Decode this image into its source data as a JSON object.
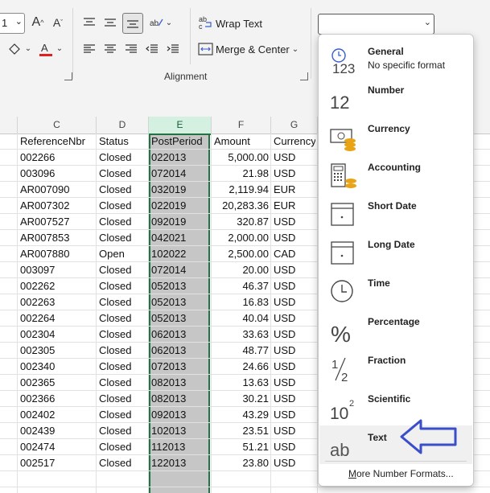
{
  "ribbon": {
    "font_size_value": "1",
    "wrap_text_label": "Wrap Text",
    "merge_center_label": "Merge & Center",
    "alignment_group_label": "Alignment",
    "number_format_value": ""
  },
  "sheet": {
    "columns": [
      "C",
      "D",
      "E",
      "F",
      "G"
    ],
    "headers": [
      "ReferenceNbr",
      "Status",
      "PostPeriod",
      "Amount",
      "Currency"
    ],
    "rows": [
      [
        "002266",
        "Closed",
        "022013",
        "5,000.00",
        "USD"
      ],
      [
        "003096",
        "Closed",
        "072014",
        "21.98",
        "USD"
      ],
      [
        "AR007090",
        "Closed",
        "032019",
        "2,119.94",
        "EUR"
      ],
      [
        "AR007302",
        "Closed",
        "022019",
        "20,283.36",
        "EUR"
      ],
      [
        "AR007527",
        "Closed",
        "092019",
        "320.87",
        "USD"
      ],
      [
        "AR007853",
        "Closed",
        "042021",
        "2,000.00",
        "USD"
      ],
      [
        "AR007880",
        "Open",
        "102022",
        "2,500.00",
        "CAD"
      ],
      [
        "003097",
        "Closed",
        "072014",
        "20.00",
        "USD"
      ],
      [
        "002262",
        "Closed",
        "052013",
        "46.37",
        "USD"
      ],
      [
        "002263",
        "Closed",
        "052013",
        "16.83",
        "USD"
      ],
      [
        "002264",
        "Closed",
        "052013",
        "40.04",
        "USD"
      ],
      [
        "002304",
        "Closed",
        "062013",
        "33.63",
        "USD"
      ],
      [
        "002305",
        "Closed",
        "062013",
        "48.77",
        "USD"
      ],
      [
        "002340",
        "Closed",
        "072013",
        "24.66",
        "USD"
      ],
      [
        "002365",
        "Closed",
        "082013",
        "13.63",
        "USD"
      ],
      [
        "002366",
        "Closed",
        "082013",
        "30.21",
        "USD"
      ],
      [
        "002402",
        "Closed",
        "092013",
        "43.29",
        "USD"
      ],
      [
        "002439",
        "Closed",
        "102013",
        "23.51",
        "USD"
      ],
      [
        "002474",
        "Closed",
        "112013",
        "51.21",
        "USD"
      ],
      [
        "002517",
        "Closed",
        "122013",
        "23.80",
        "USD"
      ]
    ]
  },
  "number_formats": {
    "items": [
      {
        "name": "General",
        "sub": "No specific format",
        "icon": "general-123-icon"
      },
      {
        "name": "Number",
        "sub": "",
        "icon": "number-12-icon"
      },
      {
        "name": "Currency",
        "sub": "",
        "icon": "currency-icon"
      },
      {
        "name": "Accounting",
        "sub": "",
        "icon": "accounting-icon"
      },
      {
        "name": "Short Date",
        "sub": "",
        "icon": "calendar-icon"
      },
      {
        "name": "Long Date",
        "sub": "",
        "icon": "calendar-icon"
      },
      {
        "name": "Time",
        "sub": "",
        "icon": "clock-icon"
      },
      {
        "name": "Percentage",
        "sub": "",
        "icon": "percent-icon"
      },
      {
        "name": "Fraction",
        "sub": "",
        "icon": "fraction-icon"
      },
      {
        "name": "Scientific",
        "sub": "",
        "icon": "scientific-icon"
      },
      {
        "name": "Text",
        "sub": "",
        "icon": "text-ab-icon"
      }
    ],
    "glyphs": {
      "general": "123",
      "number": "12",
      "fraction_num": "1",
      "fraction_den": "2",
      "scientific_base": "10",
      "scientific_exp": "2",
      "text": "ab",
      "percent": "%"
    },
    "more_label": "More Number Formats...",
    "more_underline": "M",
    "more_rest": "ore Number Formats..."
  },
  "colors": {
    "accent_green": "#217346",
    "arrow_blue": "#3a4ec9",
    "currency_gold": "#e8a317"
  }
}
